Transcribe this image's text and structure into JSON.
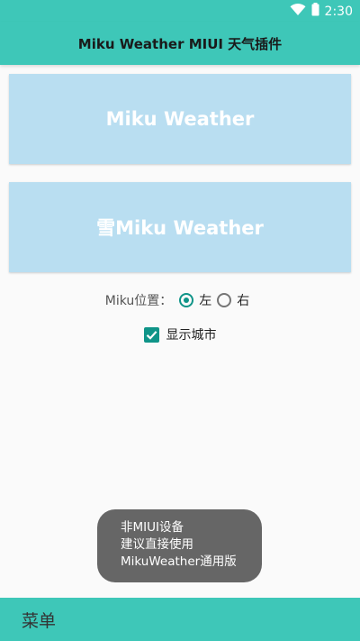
{
  "status_bar": {
    "time": "2:30",
    "icons": [
      "wifi-icon",
      "battery-icon"
    ]
  },
  "app_bar": {
    "title": "Miku Weather MIUI 天气插件"
  },
  "cards": [
    {
      "label": "Miku Weather"
    },
    {
      "label": "雪Miku Weather"
    }
  ],
  "position": {
    "label": "Miku位置：",
    "options": [
      {
        "label": "左",
        "checked": true
      },
      {
        "label": "右",
        "checked": false
      }
    ]
  },
  "show_city": {
    "label": "显示城市",
    "checked": true
  },
  "toast": {
    "lines": [
      "非MIUI设备",
      "建议直接使用",
      "MikuWeather通用版"
    ]
  },
  "bottom_bar": {
    "menu_label": "菜单"
  },
  "colors": {
    "accent": "#3ec7b8",
    "control": "#0f9488",
    "card": "#b9def1",
    "toast": "#666666"
  }
}
